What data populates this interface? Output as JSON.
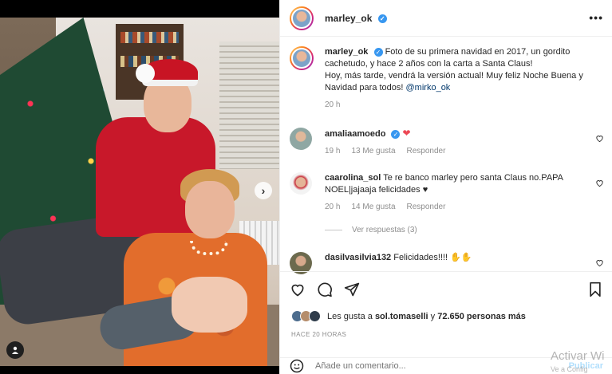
{
  "post": {
    "username": "marley_ok",
    "more_icon": "more-horizontal-icon"
  },
  "caption": {
    "username": "marley_ok",
    "text_line1": "Foto de su primera navidad en 2017, un gordito cachetudo, y hace 2 años con la carta a Santa Claus!",
    "text_line2": "Hoy, más tarde, vendrá la versión actual! Muy feliz Noche Buena y Navidad para todos!",
    "mention": "@mirko_ok",
    "time": "20 h"
  },
  "comments": [
    {
      "username": "amaliaamoedo",
      "text": "",
      "time": "19 h",
      "likes": "13 Me gusta",
      "reply": "Responder"
    },
    {
      "username": "caarolina_sol",
      "text": "Te re banco marley pero santa Claus no.PAPA NOEL|jajaaja felicidades ♥",
      "time": "20 h",
      "likes": "14 Me gusta",
      "reply": "Responder"
    },
    {
      "username": "dasilvasilvia132",
      "text": "Felicidades!!!!"
    }
  ],
  "replies_label": "Ver respuestas (3)",
  "likes": {
    "prefix": "Les gusta a ",
    "user": "sol.tomaselli",
    "middle": " y ",
    "count": "72.650 personas más"
  },
  "posted_ago": "HACE 20 HORAS",
  "add_comment": {
    "placeholder": "Añade un comentario...",
    "publish_label": "Publicar"
  },
  "watermark": {
    "line1": "Activar Wi",
    "line2": "Ve a Config"
  },
  "colors": {
    "accent": "#3897f0",
    "heart": "#ed4956",
    "publish": "#b2dffc"
  }
}
